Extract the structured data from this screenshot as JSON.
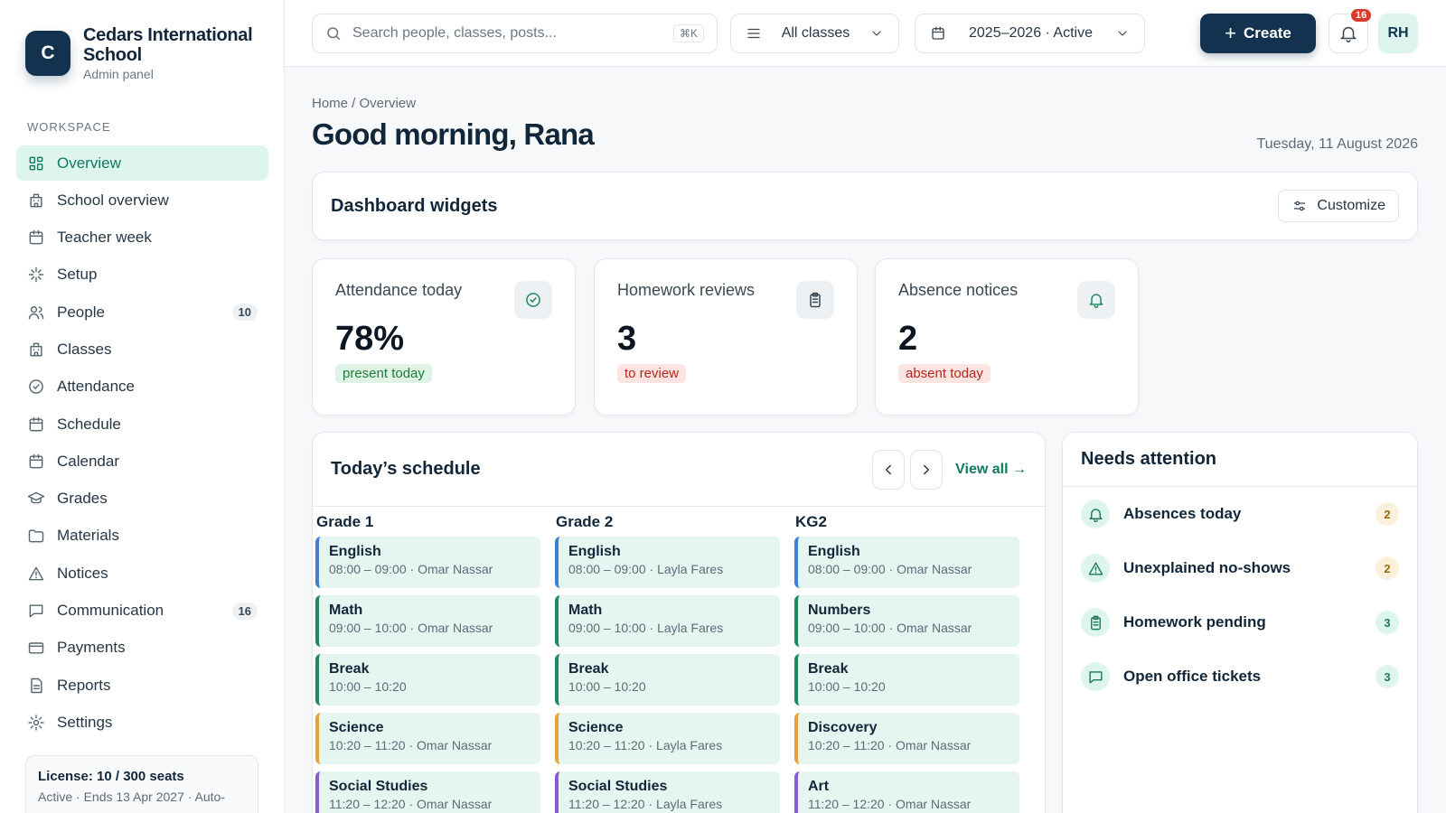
{
  "brand": {
    "logo_letter": "C",
    "name": "Cedars International School",
    "subtitle": "Admin panel"
  },
  "sidebar": {
    "section_label": "WORKSPACE",
    "items": [
      {
        "label": "Overview",
        "icon": "grid-icon",
        "active": true
      },
      {
        "label": "School overview",
        "icon": "building-icon"
      },
      {
        "label": "Teacher week",
        "icon": "calendar-icon"
      },
      {
        "label": "Setup",
        "icon": "sparkle-icon"
      },
      {
        "label": "People",
        "icon": "people-icon",
        "badge": "10"
      },
      {
        "label": "Classes",
        "icon": "building-icon"
      },
      {
        "label": "Attendance",
        "icon": "check-circle-icon"
      },
      {
        "label": "Schedule",
        "icon": "calendar-icon"
      },
      {
        "label": "Calendar",
        "icon": "calendar-icon"
      },
      {
        "label": "Grades",
        "icon": "graduation-cap-icon"
      },
      {
        "label": "Materials",
        "icon": "folder-icon"
      },
      {
        "label": "Notices",
        "icon": "warning-icon"
      },
      {
        "label": "Communication",
        "icon": "chat-icon",
        "badge": "16"
      },
      {
        "label": "Payments",
        "icon": "card-icon"
      },
      {
        "label": "Reports",
        "icon": "document-icon"
      },
      {
        "label": "Settings",
        "icon": "gear-icon"
      }
    ],
    "license": {
      "title": "License: 10 / 300 seats",
      "subtitle": "Active · Ends 13 Apr 2027 · Auto-"
    }
  },
  "topbar": {
    "search_placeholder": "Search people, classes, posts...",
    "search_shortcut": "⌘K",
    "class_filter": "All classes",
    "year_filter": "2025–2026 · Active",
    "create_label": "Create",
    "notification_count": "16",
    "avatar_initials": "RH"
  },
  "page": {
    "breadcrumb": "Home / Overview",
    "title": "Good morning, Rana",
    "date": "Tuesday, 11 August 2026"
  },
  "widgets": {
    "title": "Dashboard widgets",
    "customize_label": "Customize"
  },
  "stats": [
    {
      "label": "Attendance today",
      "value": "78%",
      "pill": "present today",
      "icon": "check-circle-icon"
    },
    {
      "label": "Homework reviews",
      "value": "3",
      "pill": "to review",
      "icon": "clipboard-icon"
    },
    {
      "label": "Absence notices",
      "value": "2",
      "pill": "absent today",
      "icon": "bell-icon"
    }
  ],
  "schedule": {
    "title": "Today’s schedule",
    "view_all": "View all →",
    "columns": [
      {
        "name": "Grade 1",
        "lessons": [
          {
            "title": "English",
            "sub": "08:00 – 09:00 · Omar Nassar",
            "accent": "blue"
          },
          {
            "title": "Math",
            "sub": "09:00 – 10:00 · Omar Nassar",
            "accent": "green"
          },
          {
            "title": "Break",
            "sub": "10:00 – 10:20",
            "accent": "green"
          },
          {
            "title": "Science",
            "sub": "10:20 – 11:20 · Omar Nassar",
            "accent": "orange"
          },
          {
            "title": "Social Studies",
            "sub": "11:20 – 12:20 · Omar Nassar",
            "accent": "purple"
          }
        ]
      },
      {
        "name": "Grade 2",
        "lessons": [
          {
            "title": "English",
            "sub": "08:00 – 09:00 · Layla Fares",
            "accent": "blue"
          },
          {
            "title": "Math",
            "sub": "09:00 – 10:00 · Layla Fares",
            "accent": "green"
          },
          {
            "title": "Break",
            "sub": "10:00 – 10:20",
            "accent": "green"
          },
          {
            "title": "Science",
            "sub": "10:20 – 11:20 · Layla Fares",
            "accent": "orange"
          },
          {
            "title": "Social Studies",
            "sub": "11:20 – 12:20 · Layla Fares",
            "accent": "purple"
          }
        ]
      },
      {
        "name": "KG2",
        "lessons": [
          {
            "title": "English",
            "sub": "08:00 – 09:00 · Omar Nassar",
            "accent": "blue"
          },
          {
            "title": "Numbers",
            "sub": "09:00 – 10:00 · Omar Nassar",
            "accent": "green"
          },
          {
            "title": "Break",
            "sub": "10:00 – 10:20",
            "accent": "green"
          },
          {
            "title": "Discovery",
            "sub": "10:20 – 11:20 · Omar Nassar",
            "accent": "orange"
          },
          {
            "title": "Art",
            "sub": "11:20 – 12:20 · Omar Nassar",
            "accent": "purple"
          }
        ]
      }
    ]
  },
  "attention": {
    "title": "Needs attention",
    "items": [
      {
        "label": "Absences today",
        "count": "2",
        "icon": "bell-icon"
      },
      {
        "label": "Unexplained no-shows",
        "count": "2",
        "icon": "warning-icon"
      },
      {
        "label": "Homework pending",
        "count": "3",
        "icon": "clipboard-icon"
      },
      {
        "label": "Open office tickets",
        "count": "3",
        "icon": "chat-icon"
      }
    ]
  },
  "colors": {
    "primary": "#12324f",
    "accent": "#0f7a5c",
    "active_bg": "#def5ee"
  }
}
